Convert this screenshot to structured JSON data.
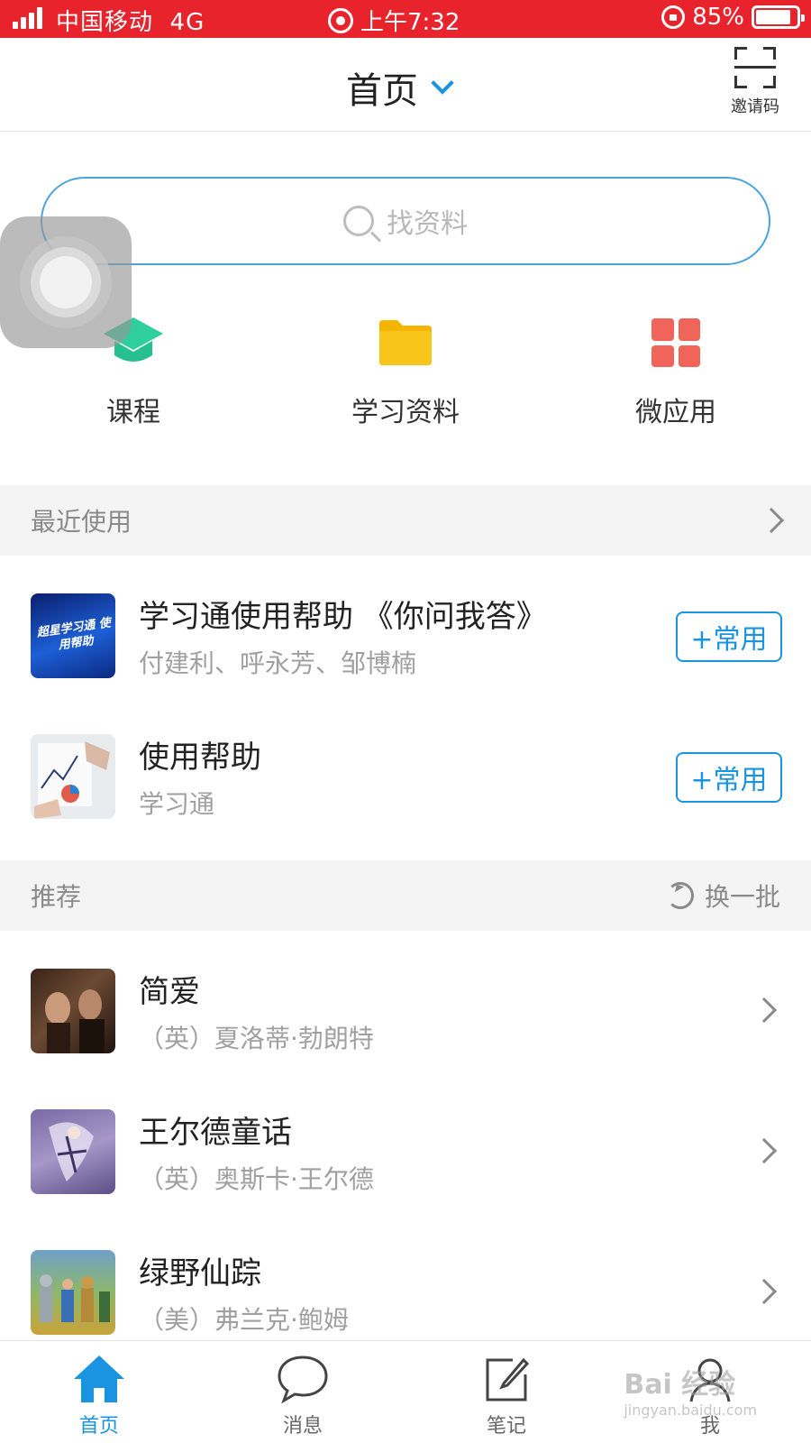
{
  "status_bar": {
    "carrier": "中国移动",
    "network": "4G",
    "time": "上午7:32",
    "battery": "85%"
  },
  "nav": {
    "title": "首页",
    "invite_label": "邀请码"
  },
  "search": {
    "placeholder": "找资料"
  },
  "quick_actions": [
    {
      "label": "课程",
      "icon": "graduation-cap-icon",
      "color": "#2fcf9b"
    },
    {
      "label": "学习资料",
      "icon": "folder-icon",
      "color": "#f8c51b"
    },
    {
      "label": "微应用",
      "icon": "apps-grid-icon",
      "color": "#f0645a"
    }
  ],
  "recent": {
    "header": "最近使用",
    "items": [
      {
        "title": "学习通使用帮助 《你问我答》",
        "subtitle": "付建利、呼永芳、邹博楠",
        "action": "+常用",
        "thumb_text": "超星学习通 使用帮助"
      },
      {
        "title": "使用帮助",
        "subtitle": "学习通",
        "action": "+常用"
      }
    ]
  },
  "recommend": {
    "header": "推荐",
    "refresh_label": "换一批",
    "items": [
      {
        "title": "简爱",
        "subtitle": "（英）夏洛蒂·勃朗特"
      },
      {
        "title": "王尔德童话",
        "subtitle": "（英）奥斯卡·王尔德"
      },
      {
        "title": "绿野仙踪",
        "subtitle": "（美）弗兰克·鲍姆"
      }
    ]
  },
  "tabbar": [
    {
      "label": "首页",
      "icon": "home-icon",
      "active": true
    },
    {
      "label": "消息",
      "icon": "chat-bubble-icon",
      "active": false
    },
    {
      "label": "笔记",
      "icon": "note-edit-icon",
      "active": false
    },
    {
      "label": "我",
      "icon": "user-icon",
      "active": false
    }
  ],
  "watermark": {
    "brand": "Bai 经验",
    "url": "jingyan.baidu.com"
  },
  "colors": {
    "status_bar": "#e8232c",
    "accent": "#1a94e0"
  }
}
